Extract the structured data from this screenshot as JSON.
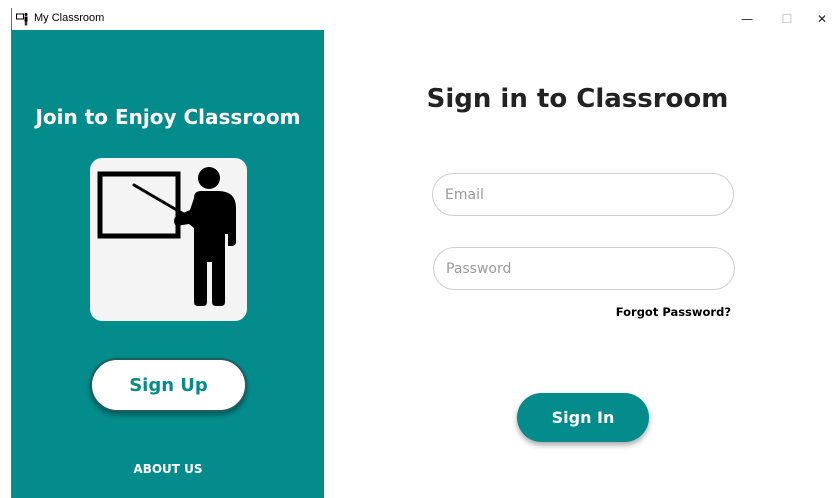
{
  "window": {
    "title": "My Classroom",
    "minimize_glyph": "—",
    "maximize_glyph": "☐",
    "close_glyph": "✕"
  },
  "left_panel": {
    "heading": "Join to Enjoy Classroom",
    "illustration_icon": "teacher-at-board-icon",
    "signup_label": "Sign Up",
    "about_label": "ABOUT US"
  },
  "form": {
    "heading": "Sign in to Classroom",
    "email_placeholder": "Email",
    "email_value": "",
    "password_placeholder": "Password",
    "password_value": "",
    "forgot_label": "Forgot Password?",
    "signin_label": "Sign In"
  },
  "colors": {
    "teal": "#048b8c",
    "white": "#ffffff",
    "text_dark": "#222222"
  }
}
